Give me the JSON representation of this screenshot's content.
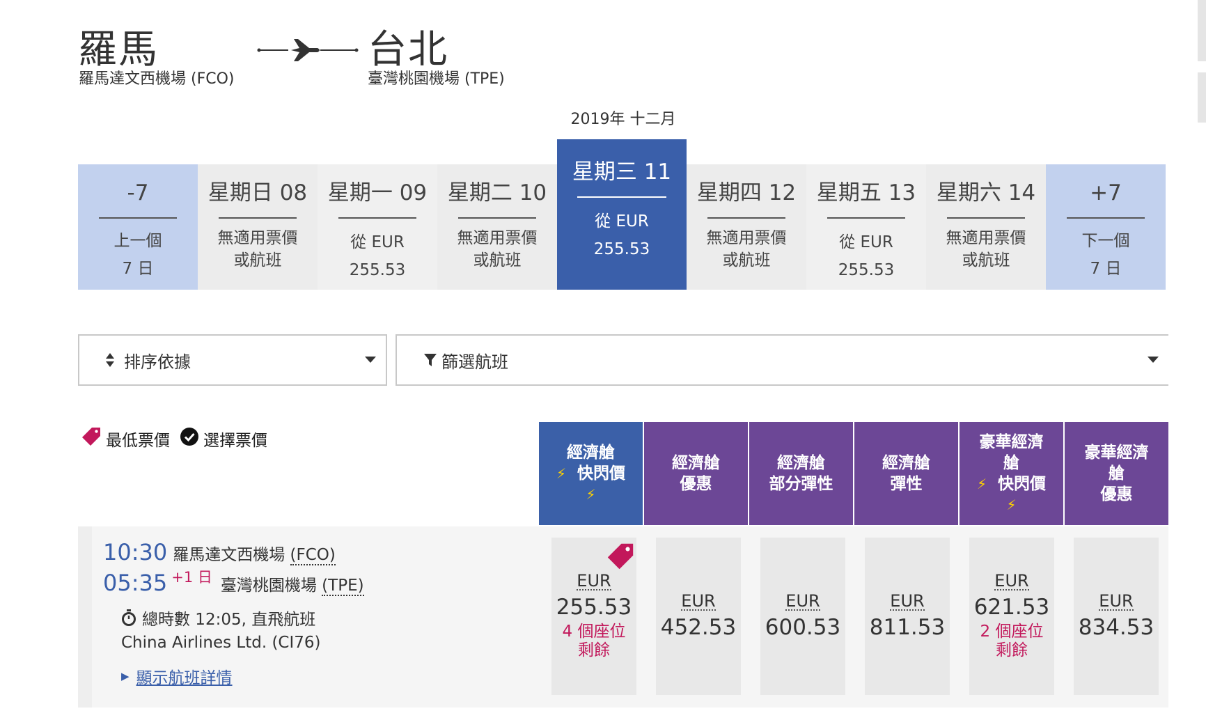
{
  "route": {
    "origin_city": "羅馬",
    "origin_airport": "羅馬達文西機場 (FCO)",
    "destination_city": "台北",
    "destination_airport": "臺灣桃園機場 (TPE)"
  },
  "calendar": {
    "month_title": "2019年 十二月",
    "prev": {
      "label": "-7",
      "sub1": "上一個",
      "sub2": "7 日"
    },
    "next": {
      "label": "+7",
      "sub1": "下一個",
      "sub2": "7 日"
    },
    "days": [
      {
        "day": "星期日 08",
        "l1": "無適用票價",
        "l2": "或航班",
        "state": "na"
      },
      {
        "day": "星期一 09",
        "l1": "從 EUR",
        "l2": "255.53",
        "state": "price"
      },
      {
        "day": "星期二 10",
        "l1": "無適用票價",
        "l2": "或航班",
        "state": "na"
      },
      {
        "day": "星期三 11",
        "l1": "從 EUR",
        "l2": "255.53",
        "state": "selected"
      },
      {
        "day": "星期四 12",
        "l1": "無適用票價",
        "l2": "或航班",
        "state": "na"
      },
      {
        "day": "星期五 13",
        "l1": "從 EUR",
        "l2": "255.53",
        "state": "price"
      },
      {
        "day": "星期六 14",
        "l1": "無適用票價",
        "l2": "或航班",
        "state": "na"
      }
    ]
  },
  "controls": {
    "sort_label": "排序依據",
    "filter_label": "篩選航班"
  },
  "legend": {
    "lowest": "最低票價",
    "selected": "選擇票價"
  },
  "fare_columns": [
    {
      "l1": "經濟艙",
      "l2": "快閃價",
      "flash": true,
      "color": "#3b60a8"
    },
    {
      "l1": "經濟艙",
      "l2": "優惠",
      "flash": false,
      "color": "#6c4796"
    },
    {
      "l1": "經濟艙",
      "l2": "部分彈性",
      "flash": false,
      "color": "#6c4796"
    },
    {
      "l1": "經濟艙",
      "l2": "彈性",
      "flash": false,
      "color": "#6c4796"
    },
    {
      "l1": "豪華經濟",
      "l1b": "艙",
      "l2": "快閃價",
      "flash": true,
      "color": "#6c4796"
    },
    {
      "l1": "豪華經濟",
      "l1b": "艙",
      "l2": "優惠",
      "flash": false,
      "color": "#6c4796"
    }
  ],
  "flight": {
    "dep_time": "10:30",
    "dep_airport": "羅馬達文西機場",
    "dep_code": "(FCO)",
    "arr_time": "05:35",
    "arr_plus": "+1 日",
    "arr_airport": "臺灣桃園機場",
    "arr_code": "(TPE)",
    "duration": "總時數 12:05, 直飛航班",
    "airline": "China Airlines Ltd. (CI76)",
    "details_link": "顯示航班詳情",
    "prices": [
      {
        "currency": "EUR",
        "amount": "255.53",
        "seats1": "4 個座位",
        "seats2": "剩餘",
        "lowest": true
      },
      {
        "currency": "EUR",
        "amount": "452.53"
      },
      {
        "currency": "EUR",
        "amount": "600.53"
      },
      {
        "currency": "EUR",
        "amount": "811.53"
      },
      {
        "currency": "EUR",
        "amount": "621.53",
        "seats1": "2 個座位",
        "seats2": "剩餘"
      },
      {
        "currency": "EUR",
        "amount": "834.53"
      }
    ]
  },
  "colors": {
    "selected_blue": "#3a5faa",
    "nav_light_blue": "#c2d1ee",
    "premium_purple": "#6c4796",
    "accent_pink": "#c2185b",
    "flash_yellow": "#ffd200"
  }
}
